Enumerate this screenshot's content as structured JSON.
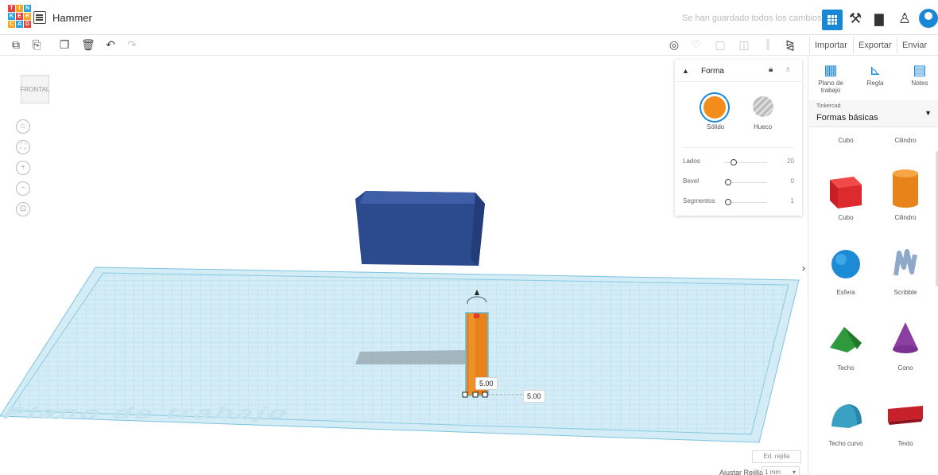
{
  "app": {
    "logo_letters": [
      "T",
      "I",
      "N",
      "K",
      "E",
      "R",
      "C",
      "A",
      "D"
    ],
    "project_name": "Hammer",
    "save_status": "Se han guardado todos los cambios.",
    "brand_color": "#1a87d6"
  },
  "toolbar": {
    "left_icons": [
      "copy-icon",
      "paste-icon",
      "duplicate-icon",
      "delete-icon",
      "undo-icon",
      "redo-icon"
    ],
    "right_icons": [
      "notes-view-icon",
      "light-icon",
      "group-icon",
      "ungroup-icon",
      "align-icon",
      "mirror-icon"
    ],
    "import_label": "Importar",
    "export_label": "Exportar",
    "send_label": "Enviar a"
  },
  "viewport": {
    "viewcube_label": "FRONTAL",
    "workplane_label": "Plano de trabajo",
    "dimension_height": "5.00",
    "dimension_width": "5.00",
    "edit_grid_label": "Ed. rejilla",
    "snap_grid_label": "Ajustar Rejilla",
    "snap_grid_value": "1 mm"
  },
  "shape_panel": {
    "title": "Forma",
    "solid_label": "Sólido",
    "hole_label": "Hueco",
    "solid_color": "#f28c1b",
    "params": [
      {
        "label": "Lados",
        "value": "20",
        "level": 0.15
      },
      {
        "label": "Bevel",
        "value": "0",
        "level": 0.0
      },
      {
        "label": "Segmentos",
        "value": "1",
        "level": 0.0
      }
    ]
  },
  "right_panel": {
    "tools": [
      {
        "label": "Plano de trabajo",
        "icon": "workplane-icon"
      },
      {
        "label": "Regla",
        "icon": "ruler-icon"
      },
      {
        "label": "Notes",
        "icon": "notes-icon"
      }
    ],
    "category_caption": "Tinkercad",
    "category_value": "Formas básicas",
    "partial_row": [
      "Cubo",
      "Cilindro"
    ],
    "shapes": [
      {
        "label": "Cubo",
        "icon": "box-icon",
        "color": "#d9262b"
      },
      {
        "label": "Cilindro",
        "icon": "cylinder-icon",
        "color": "#e8821a"
      },
      {
        "label": "Esfera",
        "icon": "sphere-icon",
        "color": "#1d8ad6"
      },
      {
        "label": "Scribble",
        "icon": "scribble-icon",
        "color": "#8fa9c8"
      },
      {
        "label": "Techo",
        "icon": "roof-icon",
        "color": "#2f9a3c"
      },
      {
        "label": "Cono",
        "icon": "cone-icon",
        "color": "#8b3fa0"
      },
      {
        "label": "Techo curvo",
        "icon": "round-roof-icon",
        "color": "#3aa0c4"
      },
      {
        "label": "Texto",
        "icon": "text-icon",
        "color": "#c6202a"
      }
    ]
  }
}
